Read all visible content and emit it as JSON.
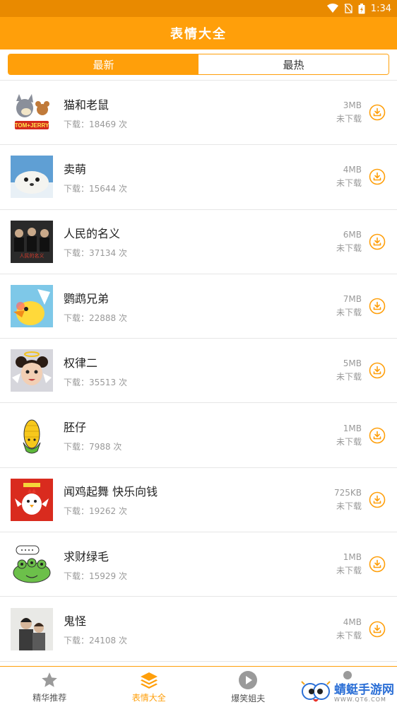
{
  "status_bar": {
    "time": "1:34"
  },
  "app_bar": {
    "title": "表情大全"
  },
  "tabs": [
    {
      "label": "最新",
      "active": true
    },
    {
      "label": "最热",
      "active": false
    }
  ],
  "download_prefix": "下载：",
  "download_suffix": " 次",
  "items": [
    {
      "name": "猫和老鼠",
      "downloads": "下载：18469 次",
      "size": "3MB",
      "status": "未下载",
      "thumb": "tom-and-jerry-icon"
    },
    {
      "name": "卖萌",
      "downloads": "下载：15644 次",
      "size": "4MB",
      "status": "未下载",
      "thumb": "seal-icon"
    },
    {
      "name": "人民的名义",
      "downloads": "下载：37134 次",
      "size": "6MB",
      "status": "未下载",
      "thumb": "drama-poster-icon"
    },
    {
      "name": "鹦鹉兄弟",
      "downloads": "下载：22888 次",
      "size": "7MB",
      "status": "未下载",
      "thumb": "parrot-icon"
    },
    {
      "name": "权律二",
      "downloads": "下载：35513 次",
      "size": "5MB",
      "status": "未下载",
      "thumb": "angel-girl-icon"
    },
    {
      "name": "胚仔",
      "downloads": "下载：7988 次",
      "size": "1MB",
      "status": "未下载",
      "thumb": "corn-icon"
    },
    {
      "name": "闻鸡起舞 快乐向钱",
      "downloads": "下载：19262 次",
      "size": "725KB",
      "status": "未下载",
      "thumb": "chicken-icon"
    },
    {
      "name": "求财绿毛",
      "downloads": "下载：15929 次",
      "size": "1MB",
      "status": "未下载",
      "thumb": "green-monster-icon"
    },
    {
      "name": "鬼怪",
      "downloads": "下载：24108 次",
      "size": "4MB",
      "status": "未下载",
      "thumb": "goblin-poster-icon"
    }
  ],
  "bottom_nav": [
    {
      "label": "精华推荐",
      "icon": "star-icon",
      "active": false
    },
    {
      "label": "表情大全",
      "icon": "layers-icon",
      "active": true
    },
    {
      "label": "爆笑姐夫",
      "icon": "play-icon",
      "active": false
    }
  ],
  "watermark": {
    "text": "蜻蜓手游网",
    "sub": "WWW.QT6.COM"
  },
  "colors": {
    "accent": "#ff9f0a",
    "status_bar": "#e98a00",
    "muted": "#999999"
  }
}
